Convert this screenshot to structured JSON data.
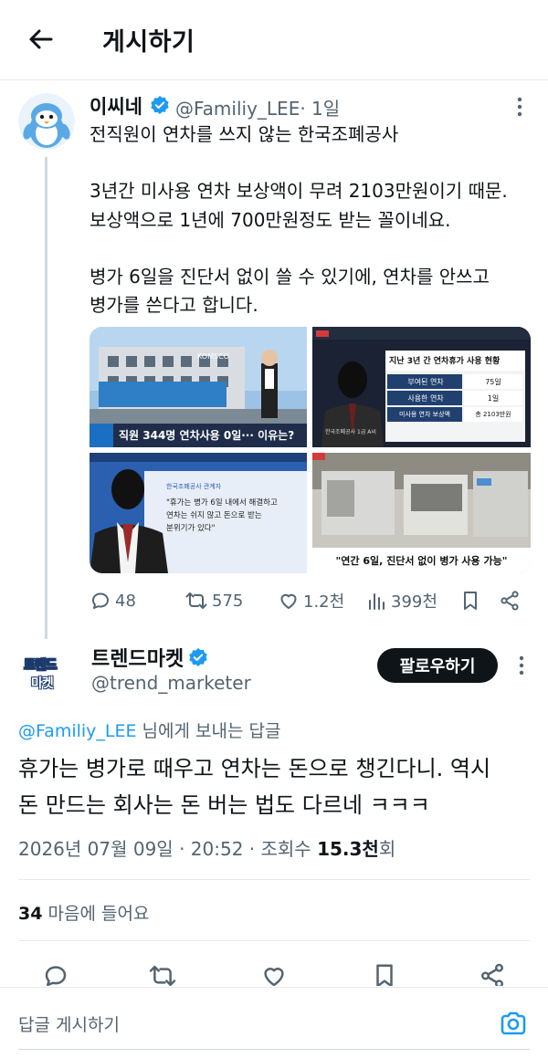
{
  "header": {
    "title": "게시하기"
  },
  "post1": {
    "name": "이씨네",
    "handle": "@Familiy_LEE",
    "time": "· 1일",
    "lines": [
      "전직원이 연차를 쓰지 않는 한국조폐공사",
      "",
      "3년간 미사용 연차 보상액이 무려 2103만원이기 때문.",
      "보상액으로 1년에 700만원정도 받는 꼴이네요.",
      "",
      "병가 6일을 진단서 없이 쓸 수 있기에, 연차를 안쓰고",
      "병가를 쓴다고 합니다."
    ],
    "media": {
      "img1_sign": "KOMSCO",
      "img1_caption": "직원 344명 연차사용 0일··· 이유는?",
      "img2_title": "지난 3년 간 연차휴가 사용 현황",
      "img2_rows": [
        {
          "label": "부여된 연차",
          "value": "75일"
        },
        {
          "label": "사용한 연차",
          "value": "1일"
        },
        {
          "label": "미사용 연차 보상액",
          "value": "총 2103만원"
        }
      ],
      "img2_person_caption": "한국조폐공사 1급 A씨",
      "img3_tag": "한국조폐공사 관계자",
      "img3_quote": [
        "\"휴가는 병가 6일 내에서 해결하고",
        "연차는 쉬지 않고 돈으로 받는",
        "분위기가 있다\""
      ],
      "img4_caption": "\"연간 6일, 진단서 없이 병가 사용 가능\""
    },
    "actions": {
      "replies": "48",
      "reposts": "575",
      "likes": "1.2천",
      "views": "399천"
    }
  },
  "post2": {
    "name": "트렌드마켓",
    "handle": "@trend_marketer",
    "avatar_text": [
      "트렌드",
      "마켓"
    ],
    "follow_label": "팔로우하기",
    "reply_mention": "@Familiy_LEE",
    "reply_suffix": " 님에게 보내는 답글",
    "lines": [
      "휴가는 병가로 때우고 연차는 돈으로 챙긴다니. 역시",
      "돈 만드는 회사는 돈 버는 법도 다르네 ㅋㅋㅋ"
    ],
    "date": "2026년 07월 09일 · 20:52 · 조회수 ",
    "views": "15.3천",
    "views_suffix": "회",
    "likes_count": "34",
    "likes_label": " 마음에 들어요"
  },
  "reply_bar": {
    "placeholder": "답글 게시하기"
  },
  "colors": {
    "accent": "#1d9bf0",
    "text": "#0f1419",
    "muted": "#536471",
    "divider": "#e6e9eb"
  }
}
